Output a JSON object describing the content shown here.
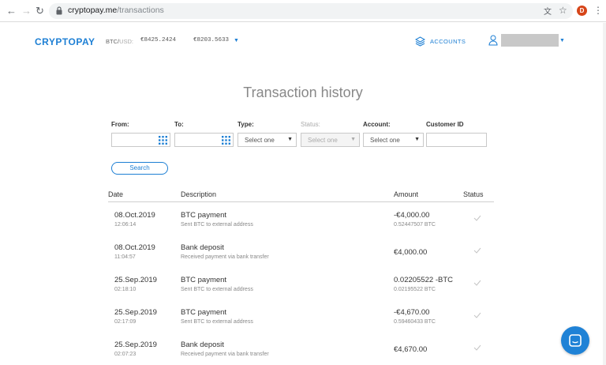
{
  "browser": {
    "url_host": "cryptopay.me",
    "url_path": "/transactions",
    "profile_initial": "D"
  },
  "header": {
    "logo": "CRYPTOPAY",
    "rate_label": "BTC/",
    "rate_label_usd": "USD:",
    "rate_buy": "€8425.2424",
    "rate_sell": "€8203.5633",
    "accounts_label": "ACCOUNTS",
    "accent_color": "#1d7fd4"
  },
  "page": {
    "title": "Transaction history"
  },
  "filters": {
    "from_label": "From:",
    "to_label": "To:",
    "type_label": "Type:",
    "type_value": "Select one",
    "status_label": "Status:",
    "status_value": "Select one",
    "account_label": "Account:",
    "account_value": "Select one",
    "customer_id_label": "Customer ID",
    "search_button": "Search"
  },
  "table": {
    "headers": {
      "date": "Date",
      "description": "Description",
      "amount": "Amount",
      "status": "Status"
    },
    "rows": [
      {
        "date": "08.Oct.2019",
        "time": "12:06:14",
        "title": "BTC payment",
        "subtitle": "Sent BTC to external address",
        "amount": "-€4,000.00",
        "amount_sub": "0.52447507 BTC",
        "status_icon": "check-icon"
      },
      {
        "date": "08.Oct.2019",
        "time": "11:04:57",
        "title": "Bank deposit",
        "subtitle": "Received payment via bank transfer",
        "amount": "€4,000.00",
        "amount_sub": "",
        "status_icon": "check-icon"
      },
      {
        "date": "25.Sep.2019",
        "time": "02:18:10",
        "title": "BTC payment",
        "subtitle": "Sent BTC to external address",
        "amount": "0.02205522 -BTC",
        "amount_sub": "0.02195522 BTC",
        "status_icon": "check-icon"
      },
      {
        "date": "25.Sep.2019",
        "time": "02:17:09",
        "title": "BTC payment",
        "subtitle": "Sent BTC to external address",
        "amount": "-€4,670.00",
        "amount_sub": "0.59460433 BTC",
        "status_icon": "check-icon"
      },
      {
        "date": "25.Sep.2019",
        "time": "02:07:23",
        "title": "Bank deposit",
        "subtitle": "Received payment via bank transfer",
        "amount": "€4,670.00",
        "amount_sub": "",
        "status_icon": "check-icon"
      }
    ]
  }
}
